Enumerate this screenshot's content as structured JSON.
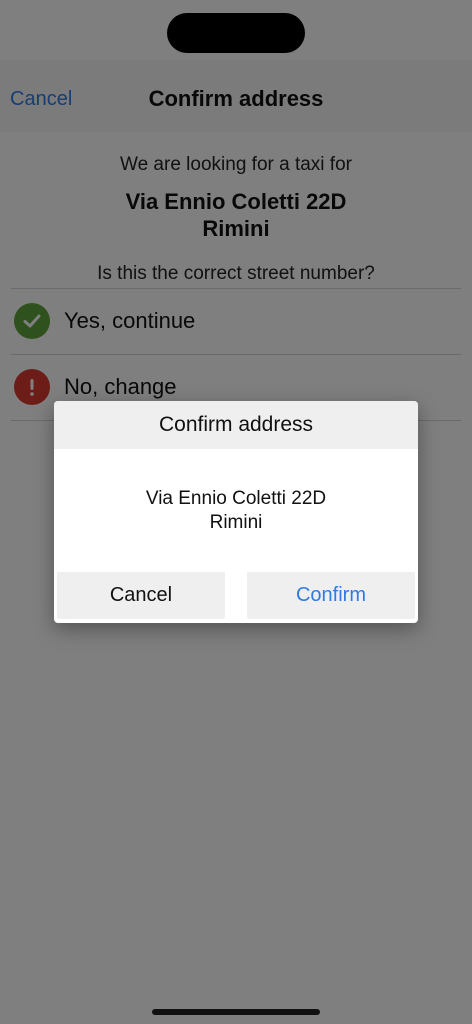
{
  "navbar": {
    "cancel_label": "Cancel",
    "title": "Confirm address"
  },
  "main": {
    "looking_text": "We are looking for a taxi for",
    "address_line1": "Via Ennio Coletti 22D",
    "address_line2": "Rimini",
    "question": "Is this the correct street number?",
    "options": [
      {
        "label": "Yes, continue",
        "icon": "check-circle-icon",
        "color": "#5ea33a"
      },
      {
        "label": "No, change",
        "icon": "exclamation-circle-icon",
        "color": "#d93a31"
      }
    ]
  },
  "dialog": {
    "title": "Confirm address",
    "address_line1": "Via Ennio Coletti 22D",
    "address_line2": "Rimini",
    "cancel_label": "Cancel",
    "confirm_label": "Confirm"
  },
  "colors": {
    "accent": "#2f7ae5"
  }
}
